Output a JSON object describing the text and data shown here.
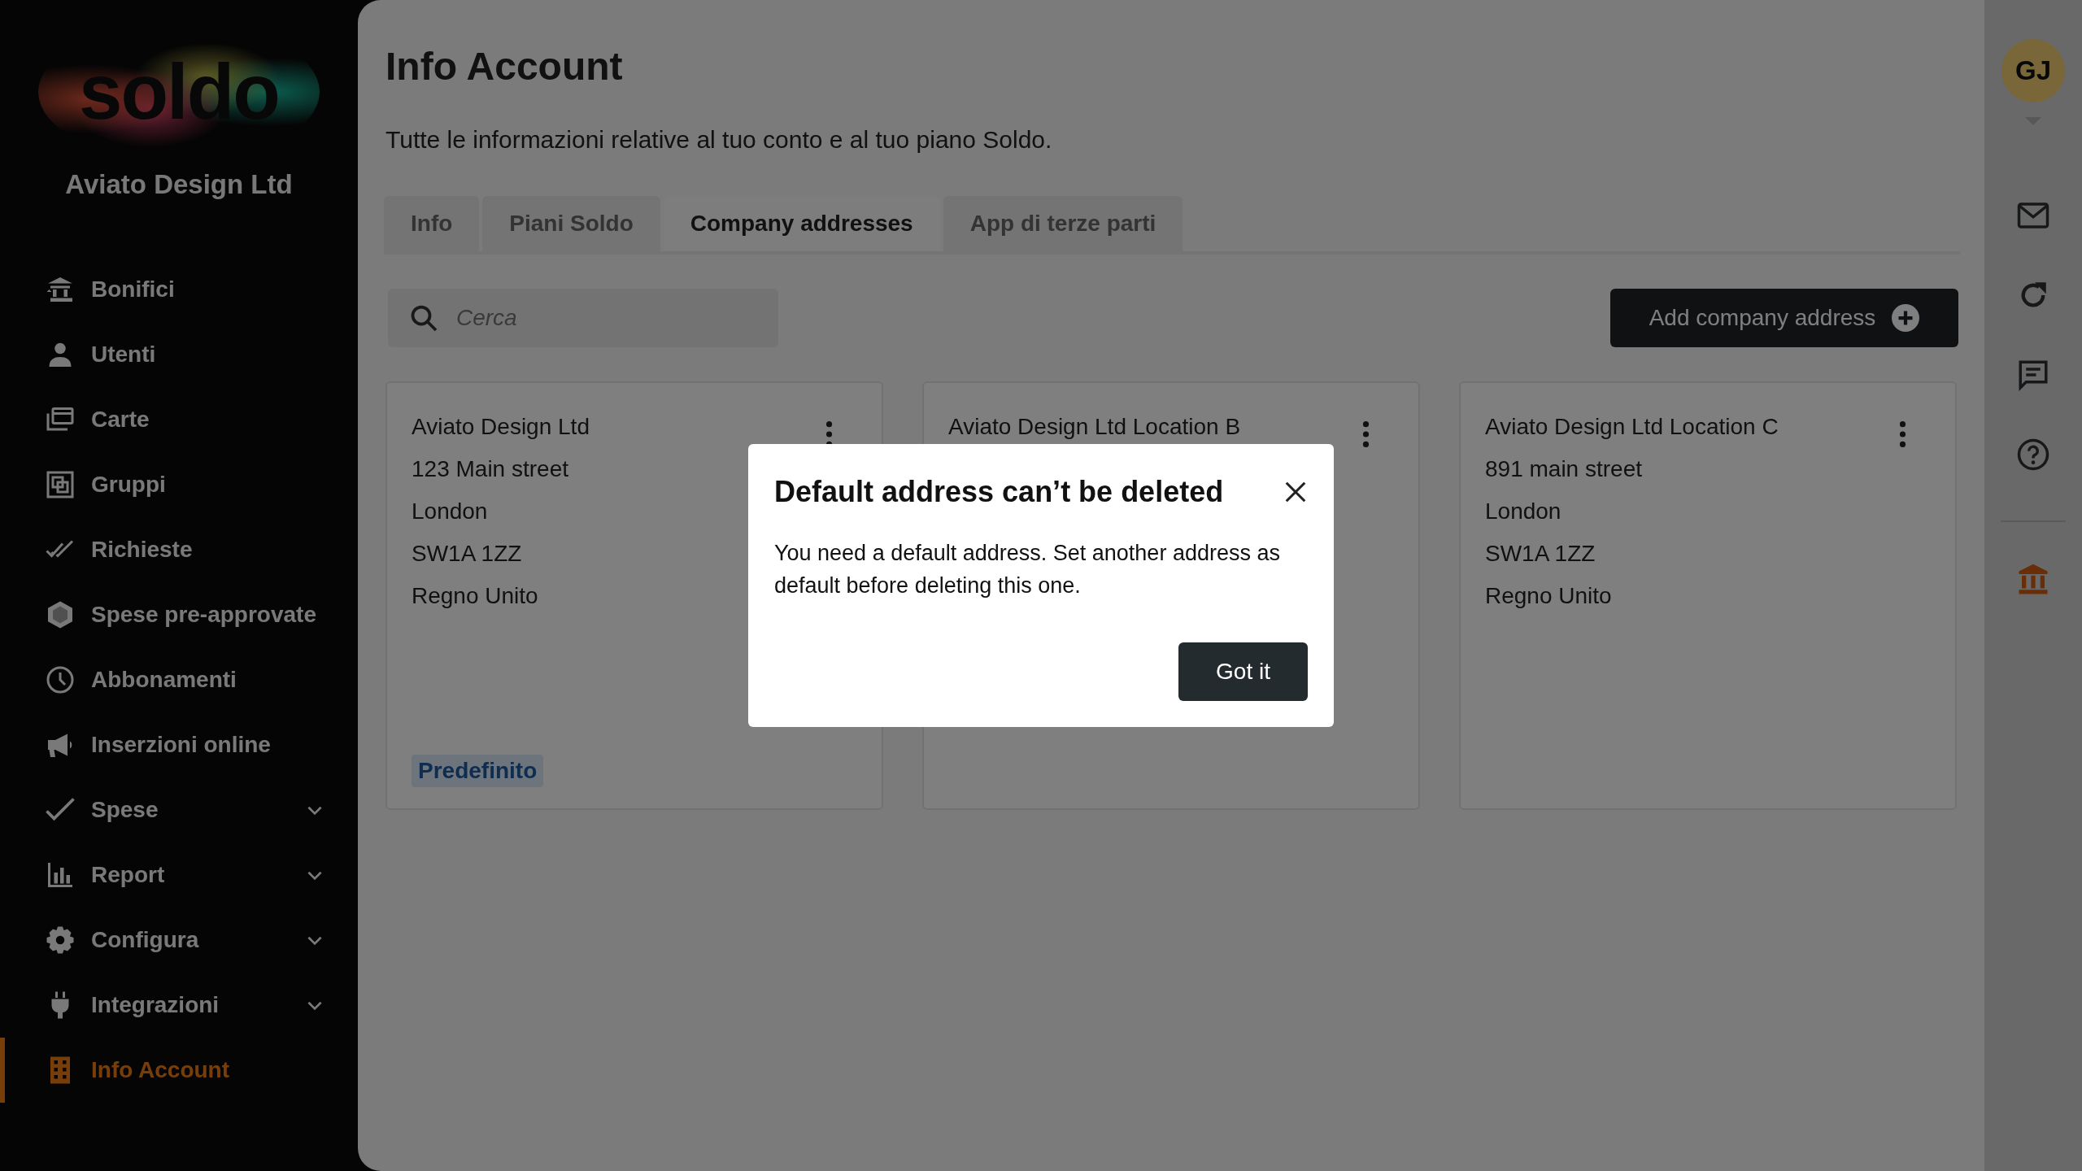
{
  "sidebar": {
    "logo": "soldo",
    "company": "Aviato Design Ltd",
    "items": [
      {
        "label": "Bonifici",
        "selected": false
      },
      {
        "label": "Utenti",
        "selected": false
      },
      {
        "label": "Carte",
        "selected": false
      },
      {
        "label": "Gruppi",
        "selected": false
      },
      {
        "label": "Richieste",
        "selected": false
      },
      {
        "label": "Spese pre-approvate",
        "selected": false
      },
      {
        "label": "Abbonamenti",
        "selected": false
      },
      {
        "label": "Inserzioni online",
        "selected": false
      },
      {
        "label": "Spese",
        "selected": false,
        "expanded": false
      },
      {
        "label": "Report",
        "selected": false,
        "expanded": false
      },
      {
        "label": "Configura",
        "selected": false,
        "expanded": false
      },
      {
        "label": "Integrazioni",
        "selected": false,
        "expanded": false
      },
      {
        "label": "Info Account",
        "selected": true
      }
    ]
  },
  "header": {
    "title": "Info Account",
    "subtitle": "Tutte le informazioni relative al tuo conto e al tuo piano Soldo."
  },
  "tabs": [
    {
      "label": "Info",
      "selected": false
    },
    {
      "label": "Piani Soldo",
      "selected": false
    },
    {
      "label": "Company addresses",
      "selected": true
    },
    {
      "label": "App di terze parti",
      "selected": false
    }
  ],
  "search": {
    "placeholder": "Cerca"
  },
  "add_button": "Add company address",
  "cards": [
    {
      "lines": [
        "Aviato Design Ltd",
        "123 Main street",
        "London",
        "SW1A 1ZZ",
        "Regno Unito"
      ],
      "badge": "Predefinito"
    },
    {
      "lines": [
        "Aviato Design Ltd Location B"
      ]
    },
    {
      "lines": [
        "Aviato Design Ltd Location C",
        "891 main street",
        "London",
        "SW1A 1ZZ",
        "Regno Unito"
      ]
    }
  ],
  "dialog": {
    "title": "Default address can’t be deleted",
    "body": "You need a default address. Set another address as default before deleting this one.",
    "button": "Got it"
  },
  "rail": {
    "avatar": "GJ"
  }
}
